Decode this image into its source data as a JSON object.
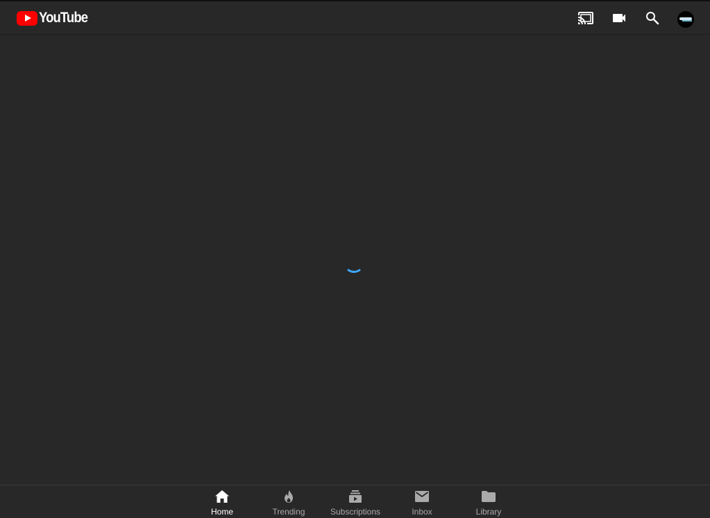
{
  "header": {
    "logo_text": "YouTube",
    "icons": [
      "cast-icon",
      "video-camera-icon",
      "search-icon",
      "avatar"
    ]
  },
  "main": {
    "state": "loading"
  },
  "bottom_nav": {
    "items": [
      {
        "label": "Home",
        "icon": "home-icon",
        "active": true
      },
      {
        "label": "Trending",
        "icon": "flame-icon",
        "active": false
      },
      {
        "label": "Subscriptions",
        "icon": "subscriptions-icon",
        "active": false
      },
      {
        "label": "Inbox",
        "icon": "mail-icon",
        "active": false
      },
      {
        "label": "Library",
        "icon": "folder-icon",
        "active": false
      }
    ]
  },
  "colors": {
    "background": "#282828",
    "brand_red": "#ff0000",
    "spinner_blue": "#3ea6ff",
    "inactive_text": "#aaaaaa"
  }
}
